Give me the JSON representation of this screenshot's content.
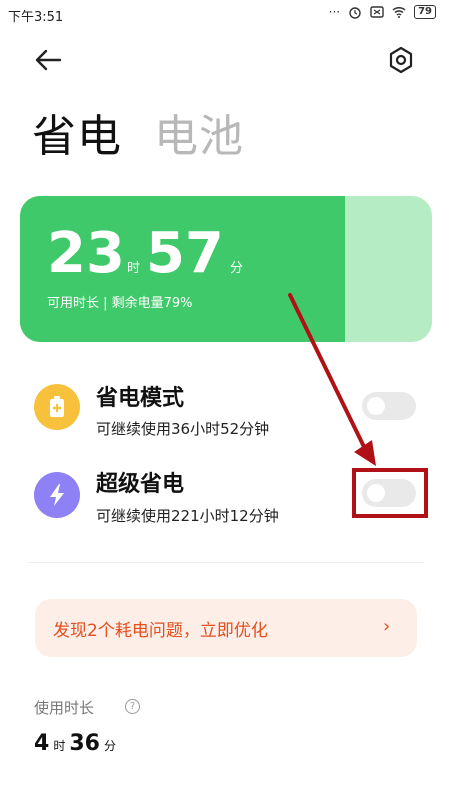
{
  "status_bar": {
    "time": "下午3:51",
    "dots": "···",
    "battery": "79"
  },
  "tabs": {
    "active": "省电",
    "inactive": "电池"
  },
  "card": {
    "hours": "23",
    "hours_unit": "时",
    "minutes": "57",
    "minutes_unit": "分",
    "subtitle": "可用时长 | 剩余电量79%",
    "battery_level_percent": 79
  },
  "modes": [
    {
      "title": "省电模式",
      "subtitle": "可继续使用36小时52分钟",
      "icon": "battery-plus-icon",
      "color": "#f7c13c",
      "enabled": false
    },
    {
      "title": "超级省电",
      "subtitle": "可继续使用221小时12分钟",
      "icon": "lightning-icon",
      "color": "#8e80f5",
      "enabled": false
    }
  ],
  "issue_banner": {
    "text": "发现2个耗电问题，立即优化",
    "chevron": "›"
  },
  "usage": {
    "label": "使用时长",
    "help": "?",
    "hours": "4",
    "hours_unit": "时",
    "minutes": "36",
    "minutes_unit": "分"
  },
  "colors": {
    "green": "#3fc96a",
    "light_green": "#b6ecc4",
    "orange": "#e2501f",
    "annotation_red": "#b01116"
  }
}
